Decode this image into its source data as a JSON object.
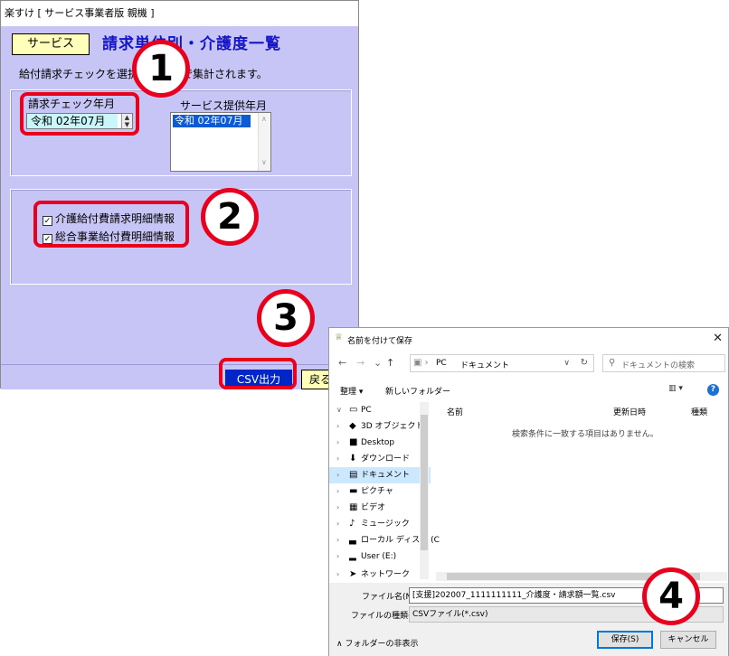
{
  "app": {
    "window_title": "楽すけ [ サービス事業者版 親機 ]",
    "service_button": "サービス",
    "header_title": "請求単位別・介護度一覧",
    "body_note": "給付請求チェックを選択した年月で集計されます。",
    "seikyu_label": "請求チェック年月",
    "seikyu_value": "令和 02年07月",
    "teikyo_label": "サービス提供年月",
    "teikyo_items": [
      "令和 02年07月"
    ],
    "checkboxes": [
      {
        "label": "介護給付費請求明細情報",
        "checked": true
      },
      {
        "label": "総合事業給付費明細情報",
        "checked": true
      }
    ],
    "csv_button": "CSV出力",
    "back_button": "戻る"
  },
  "callouts": [
    "1",
    "2",
    "3",
    "4"
  ],
  "dialog": {
    "title": "名前を付けて保存",
    "close_glyph": "✕",
    "nav": {
      "back": "←",
      "forward": "→",
      "recent": "⌄",
      "up": "↑"
    },
    "address": {
      "pc": "PC",
      "documents": "ドキュメント"
    },
    "search_placeholder": "ドキュメントの検索",
    "toolbar": {
      "organize": "整理 ▾",
      "new_folder": "新しいフォルダー",
      "view": "▥ ▾",
      "help": "?"
    },
    "tree": [
      {
        "chev": "∨",
        "icon": "pc-icon",
        "glyph": "▭",
        "label": "PC",
        "selected": false
      },
      {
        "chev": "›",
        "icon": "cube-icon",
        "glyph": "◆",
        "label": "3D オブジェクト",
        "selected": false
      },
      {
        "chev": "›",
        "icon": "desktop-icon",
        "glyph": "■",
        "label": "Desktop",
        "selected": false
      },
      {
        "chev": "›",
        "icon": "download-icon",
        "glyph": "⬇",
        "label": "ダウンロード",
        "selected": false
      },
      {
        "chev": "›",
        "icon": "document-icon",
        "glyph": "▤",
        "label": "ドキュメント",
        "selected": true
      },
      {
        "chev": "›",
        "icon": "picture-icon",
        "glyph": "▬",
        "label": "ピクチャ",
        "selected": false
      },
      {
        "chev": "›",
        "icon": "video-icon",
        "glyph": "▦",
        "label": "ビデオ",
        "selected": false
      },
      {
        "chev": "›",
        "icon": "music-icon",
        "glyph": "♪",
        "label": "ミュージック",
        "selected": false
      },
      {
        "chev": "›",
        "icon": "drive-icon",
        "glyph": "▃",
        "label": "ローカル ディスク (C",
        "selected": false
      },
      {
        "chev": "›",
        "icon": "drive-icon",
        "glyph": "▂",
        "label": "User (E:)",
        "selected": false
      },
      {
        "chev": "›",
        "icon": "network-icon",
        "glyph": "➤",
        "label": "ネットワーク",
        "selected": false
      }
    ],
    "columns": {
      "name": "名前",
      "date": "更新日時",
      "type": "種類"
    },
    "empty_message": "検索条件に一致する項目はありません。",
    "filename_label": "ファイル名(N):",
    "filename_value": "[支援]202007_1111111111_介護度・請求額一覧.csv",
    "filetype_label": "ファイルの種類(T):",
    "filetype_value": "CSVファイル(*.csv)",
    "hide_folders": "∧ フォルダーの非表示",
    "save_button": "保存(S)",
    "cancel_button": "キャンセル"
  },
  "colors": {
    "accent_red": "#e8001c",
    "panel_lavender": "#c7c5f5",
    "csv_blue": "#0026c9",
    "title_blue": "#1414c8"
  }
}
